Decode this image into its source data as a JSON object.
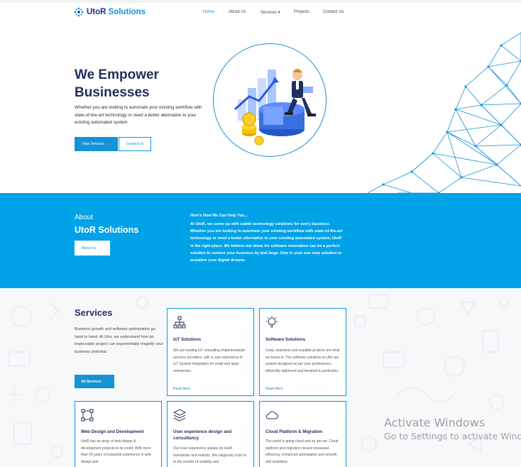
{
  "brand": {
    "name_part1": "UtoR",
    "name_part2": " Solutions",
    "accent": "#1493d6",
    "navy": "#1e2f86"
  },
  "nav": {
    "home": "Home",
    "about": "About Us",
    "services": "Services",
    "services_caret": "▾",
    "projects": "Projects",
    "contact": "Contact Us"
  },
  "hero": {
    "title": "We Empower Businesses",
    "text": "Whether you are looking to automate your existing workflow with state-of-the-art technology or need a better alternative to your existing automated system.",
    "btn_services": "View Services",
    "btn_contact": "Contact Us",
    "arrow": "→"
  },
  "about": {
    "small": "About",
    "big": "UtoR Solutions",
    "button": "About Us",
    "heading": "Here's How We Can Help You...",
    "body": "At UtoR, we come up with subtle technology solutions for every business. Whether you are looking to automate your existing workflow with state-of-the-art technology or need a better alternative to your existing automated system, UtoR is the right place. We believe our ideas for software innovation can be a perfect solution to nurture your business by and large. Utor is your one stop solution to actualize your digital dreams.",
    "band_color": "#00a2e8"
  },
  "services": {
    "title": "Services",
    "text": "Business growth and software optimization go hand in hand. At Utor, we understand how an impeccable project can exponentially magnify your business potential.",
    "button": "All Services",
    "cards": [
      {
        "icon": "network-icon",
        "title": "IoT Solutions",
        "text": "We are leading IoT consulting implementation services providers, with a vast experience in IoT System Integration for small and large enterprises.",
        "more": "Read More"
      },
      {
        "icon": "lightbulb-icon",
        "title": "Software Solutions",
        "text": "Crisp, seamless and scalable projects are what we boast of. The software solutions at Utor are custom designed as per your preferences, efficiently optimized and tweaked to perfection.",
        "more": "Read More"
      },
      {
        "icon": "vector-square-icon",
        "title": "Web Design and Development",
        "text": "UtoR has an array of web design & development projects to its credit. With more than 15 years of industrial experience in web design and"
      },
      {
        "icon": "layers-icon",
        "title": "User experience design and consultancy",
        "text": "Our User experience speaks for itself; humanistic and realistic. We religiously hold on to the mantra of usability and"
      },
      {
        "icon": "cloud-icon",
        "title": "Cloud Platform & Migration",
        "text": "The world is going cloud and so are we. Cloud platform and migration means increased efficiency, enhanced optimization and smooth and seamless"
      }
    ]
  },
  "watermark": {
    "line1": "Activate Windows",
    "line2": "Go to Settings to activate Windows."
  }
}
